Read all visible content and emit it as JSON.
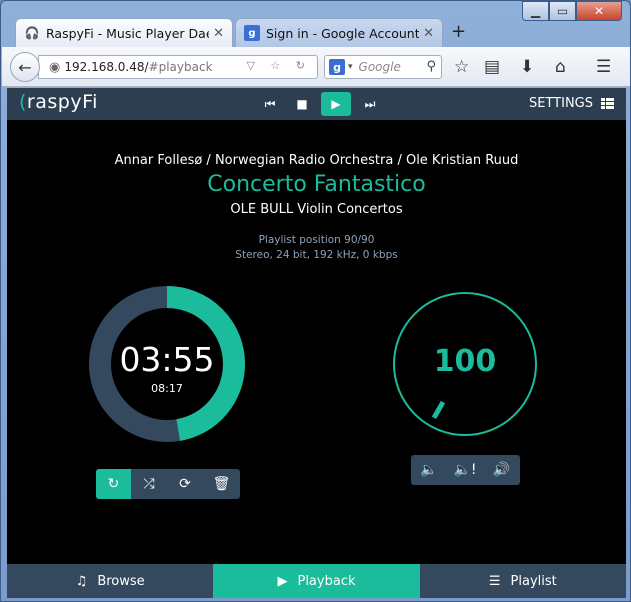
{
  "browser": {
    "tabs": [
      {
        "title": "RaspyFi - Music Player Dae...",
        "icon": "headphones-icon",
        "active": true
      },
      {
        "title": "Sign in - Google Accounts",
        "icon": "google-icon",
        "active": false
      }
    ],
    "url_host": "192.168.0.48/",
    "url_path": "#playback",
    "search_placeholder": "Google",
    "search_engine_letter": "g"
  },
  "app": {
    "logo": "raspyFi",
    "settings_label": "SETTINGS",
    "track": {
      "artist": "Annar Follesø / Norwegian Radio Orchestra / Ole Kristian Ruud",
      "title": "Concerto Fantastico",
      "album": "OLE BULL Violin Concertos",
      "playlist_position": "Playlist position 90/90",
      "format": "Stereo, 24 bit, 192 kHz, 0 kbps"
    },
    "time": {
      "elapsed": "03:55",
      "total": "08:17",
      "progress_fraction": 0.473
    },
    "volume": {
      "value": "100",
      "level_fraction": 1.0
    },
    "playback_controls": [
      "repeat-icon",
      "shuffle-icon",
      "refresh-icon",
      "trash-icon"
    ],
    "volume_controls": [
      "volume-down-icon",
      "mute-icon",
      "volume-up-icon"
    ],
    "bottom_nav": [
      {
        "label": "Browse",
        "icon": "music-icon"
      },
      {
        "label": "Playback",
        "icon": "play-icon"
      },
      {
        "label": "Playlist",
        "icon": "list-icon"
      }
    ],
    "colors": {
      "accent": "#1abc9c",
      "panel": "#34495e",
      "background": "#000000"
    }
  }
}
